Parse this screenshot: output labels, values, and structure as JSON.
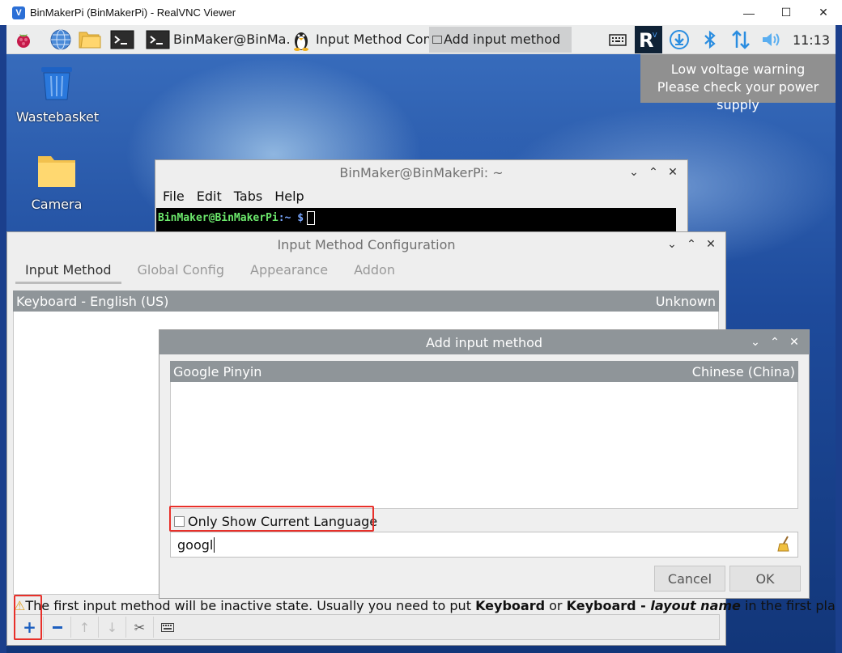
{
  "vnc": {
    "title": "BinMakerPi (BinMakerPi) - RealVNC Viewer",
    "minimize": "—",
    "maximize": "☐",
    "close": "✕"
  },
  "taskbar": {
    "tasks": [
      {
        "label": "BinMaker@BinMa..."
      },
      {
        "label": "Input Method Con..."
      },
      {
        "label": "Add input method"
      }
    ],
    "clock": "11:13"
  },
  "notification": {
    "line1": "Low voltage warning",
    "line2": "Please check your power supply"
  },
  "desktop_icons": {
    "wastebasket": "Wastebasket",
    "camera": "Camera"
  },
  "terminal": {
    "title": "BinMaker@BinMakerPi: ~",
    "menu": [
      "File",
      "Edit",
      "Tabs",
      "Help"
    ],
    "prompt_user": "BinMaker@BinMakerPi",
    "prompt_path": ":~ $"
  },
  "imconfig": {
    "title": "Input Method Configuration",
    "tabs": [
      "Input Method",
      "Global Config",
      "Appearance",
      "Addon"
    ],
    "row_name": "Keyboard - English (US)",
    "row_lang": "Unknown",
    "hint_pre": "The first input method will be inactive state. Usually you need to put ",
    "hint_b1": "Keyboard",
    "hint_mid": " or ",
    "hint_b2": "Keyboard - ",
    "hint_bi": "layout name",
    "hint_post": " in the first place."
  },
  "add_dialog": {
    "title": "Add input method",
    "row_name": "Google Pinyin",
    "row_lang": "Chinese (China)",
    "checkbox_label": "Only Show Current Language",
    "search_value": "googl",
    "cancel": "Cancel",
    "ok": "OK"
  },
  "window_buttons": {
    "down": "⌄",
    "up": "⌃",
    "close": "✕"
  },
  "colors": {
    "highlight": "#e8302a",
    "list_header": "#8f9599"
  }
}
